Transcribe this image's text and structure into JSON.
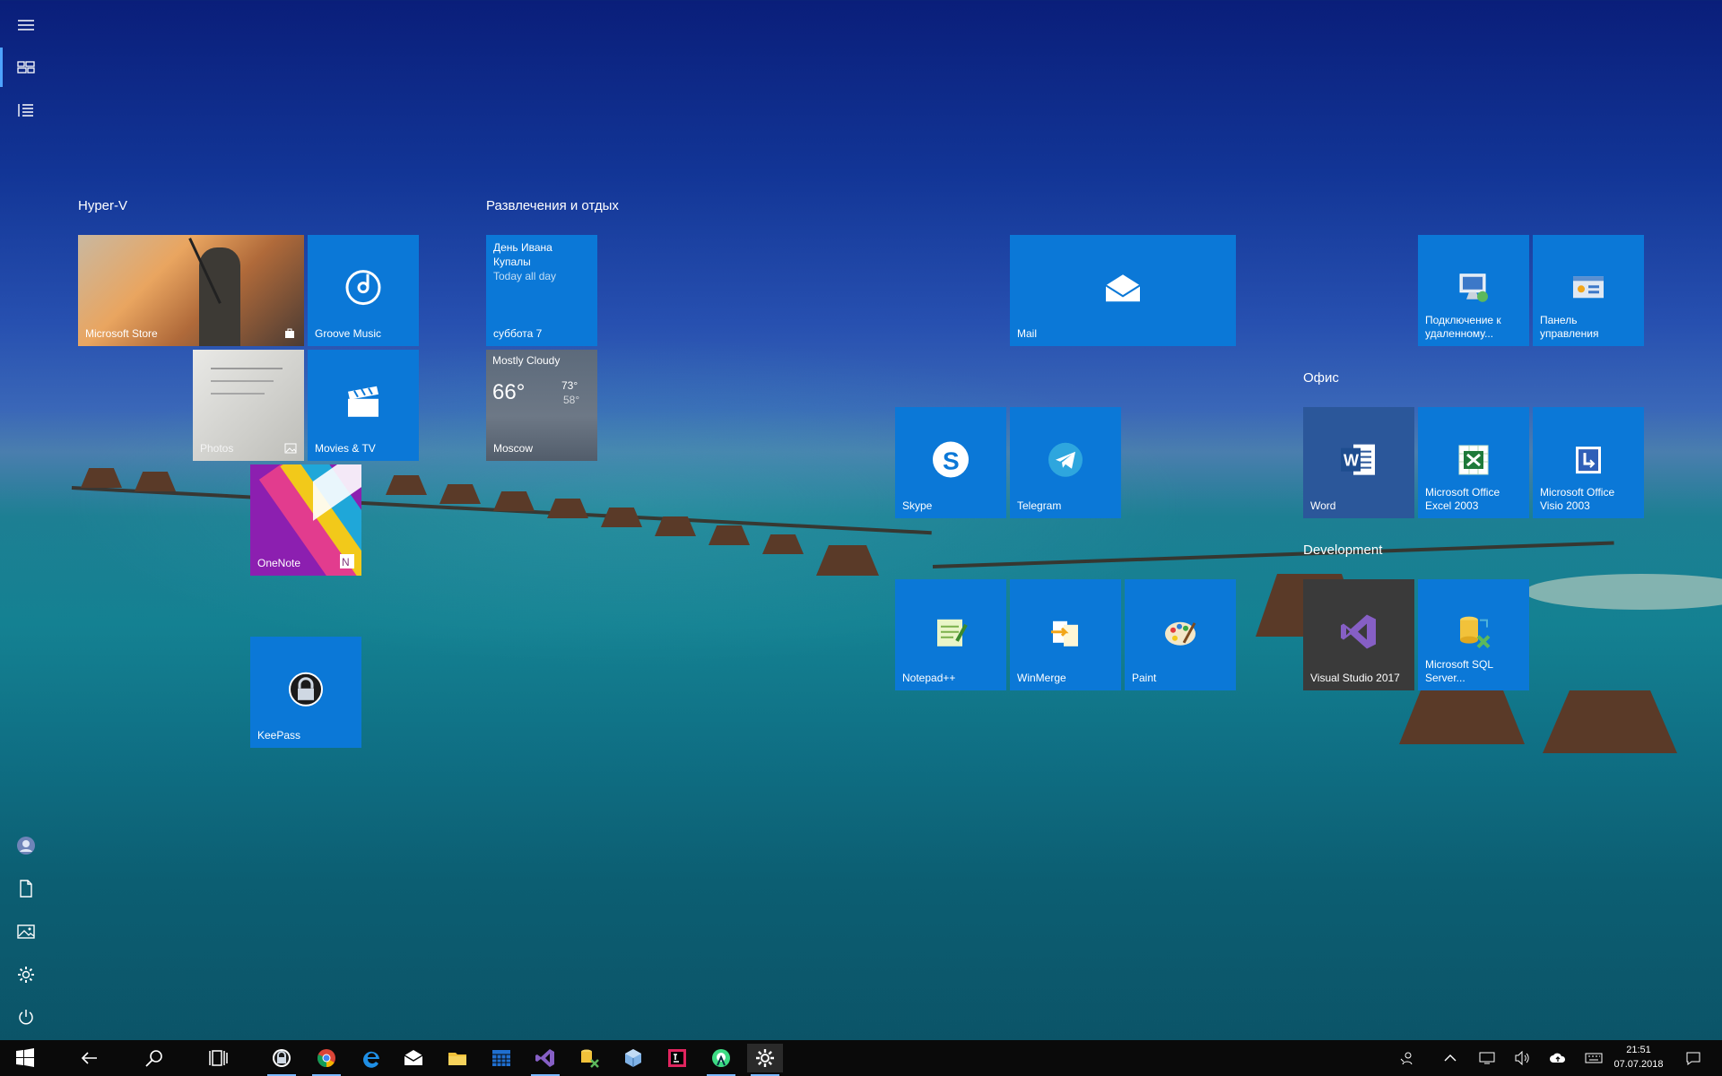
{
  "rail": {
    "items": [
      {
        "name": "hamburger-menu-icon"
      },
      {
        "name": "pinned-tiles-icon"
      },
      {
        "name": "all-apps-list-icon"
      },
      {
        "name": "user-avatar"
      },
      {
        "name": "documents-icon"
      },
      {
        "name": "pictures-icon"
      },
      {
        "name": "settings-icon"
      },
      {
        "name": "power-icon"
      }
    ]
  },
  "groups": {
    "hyperv": "Hyper-V",
    "entertainment": "Развлечения и отдых",
    "office": "Офис",
    "development": "Development"
  },
  "tiles": {
    "store": "Microsoft Store",
    "groove": "Groove Music",
    "photos": "Photos",
    "movies": "Movies & TV",
    "onenote": "OneNote",
    "keepass": "KeePass",
    "calendar_event_line1": "День Ивана",
    "calendar_event_line2": "Купалы",
    "calendar_event_time": "Today all day",
    "calendar_date": "суббота 7",
    "weather_condition": "Mostly Cloudy",
    "weather_temp": "66°",
    "weather_high": "73°",
    "weather_low": "58°",
    "weather_city": "Moscow",
    "mail": "Mail",
    "skype": "Skype",
    "telegram": "Telegram",
    "notepadpp": "Notepad++",
    "winmerge": "WinMerge",
    "paint": "Paint",
    "remote_line1": "Подключение к",
    "remote_line2": "удаленному...",
    "control_line1": "Панель",
    "control_line2": "управления",
    "word": "Word",
    "excel_line1": "Microsoft Office",
    "excel_line2": "Excel 2003",
    "visio_line1": "Microsoft Office",
    "visio_line2": "Visio 2003",
    "vs": "Visual Studio 2017",
    "sql_line1": "Microsoft SQL",
    "sql_line2": "Server..."
  },
  "taskbar": {
    "icons": [
      "windows-start-icon",
      "back-icon",
      "search-icon",
      "task-view-icon",
      "keepass-icon",
      "chrome-icon",
      "edge-icon",
      "mail-icon",
      "file-explorer-icon",
      "calculator-icon",
      "visual-studio-icon",
      "sql-server-icon",
      "virtualbox-icon",
      "jetbrains-icon",
      "android-studio-icon",
      "settings-icon"
    ],
    "time": "21:51",
    "date": "07.07.2018"
  },
  "colors": {
    "tile_blue": "#0b78d7",
    "taskbar": "#0a0a0a",
    "accent": "#4ea3ff"
  }
}
